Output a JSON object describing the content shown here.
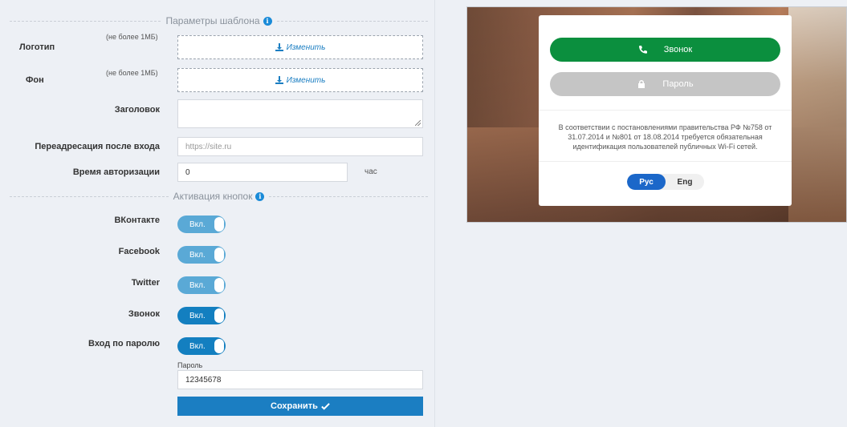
{
  "sections": {
    "template": "Параметры шаблона",
    "buttons": "Активация кнопок"
  },
  "logo": {
    "label": "Логотип",
    "note": "(не более 1МБ)",
    "action": "Изменить"
  },
  "background": {
    "label": "Фон",
    "note": "(не более 1МБ)",
    "action": "Изменить"
  },
  "heading": {
    "label": "Заголовок",
    "value": ""
  },
  "redirect": {
    "label": "Переадресация после входа",
    "placeholder": "https://site.ru"
  },
  "auth_time": {
    "label": "Время авторизации",
    "value": "0",
    "unit": "час"
  },
  "toggles": [
    {
      "label": "ВКонтакте",
      "state": "Вкл."
    },
    {
      "label": "Facebook",
      "state": "Вкл."
    },
    {
      "label": "Twitter",
      "state": "Вкл."
    },
    {
      "label": "Звонок",
      "state": "Вкл."
    },
    {
      "label": "Вход по паролю",
      "state": "Вкл."
    }
  ],
  "password": {
    "label": "Пароль",
    "value": "12345678"
  },
  "save_label": "Сохранить",
  "preview": {
    "call_button": "Звонок",
    "password_button": "Пароль",
    "legal_text": "В соответствии с постановлениями правительства РФ №758 от 31.07.2014 и №801 от 18.08.2014 требуется обязательная идентификация пользователей публичных Wi-Fi сетей.",
    "lang_ru": "Рус",
    "lang_en": "Eng"
  },
  "colors": {
    "accent": "#1b7ec2",
    "call_green": "#0b8f3e",
    "toggle_light": "#5aa9d6",
    "toggle_dark": "#137fc0"
  }
}
